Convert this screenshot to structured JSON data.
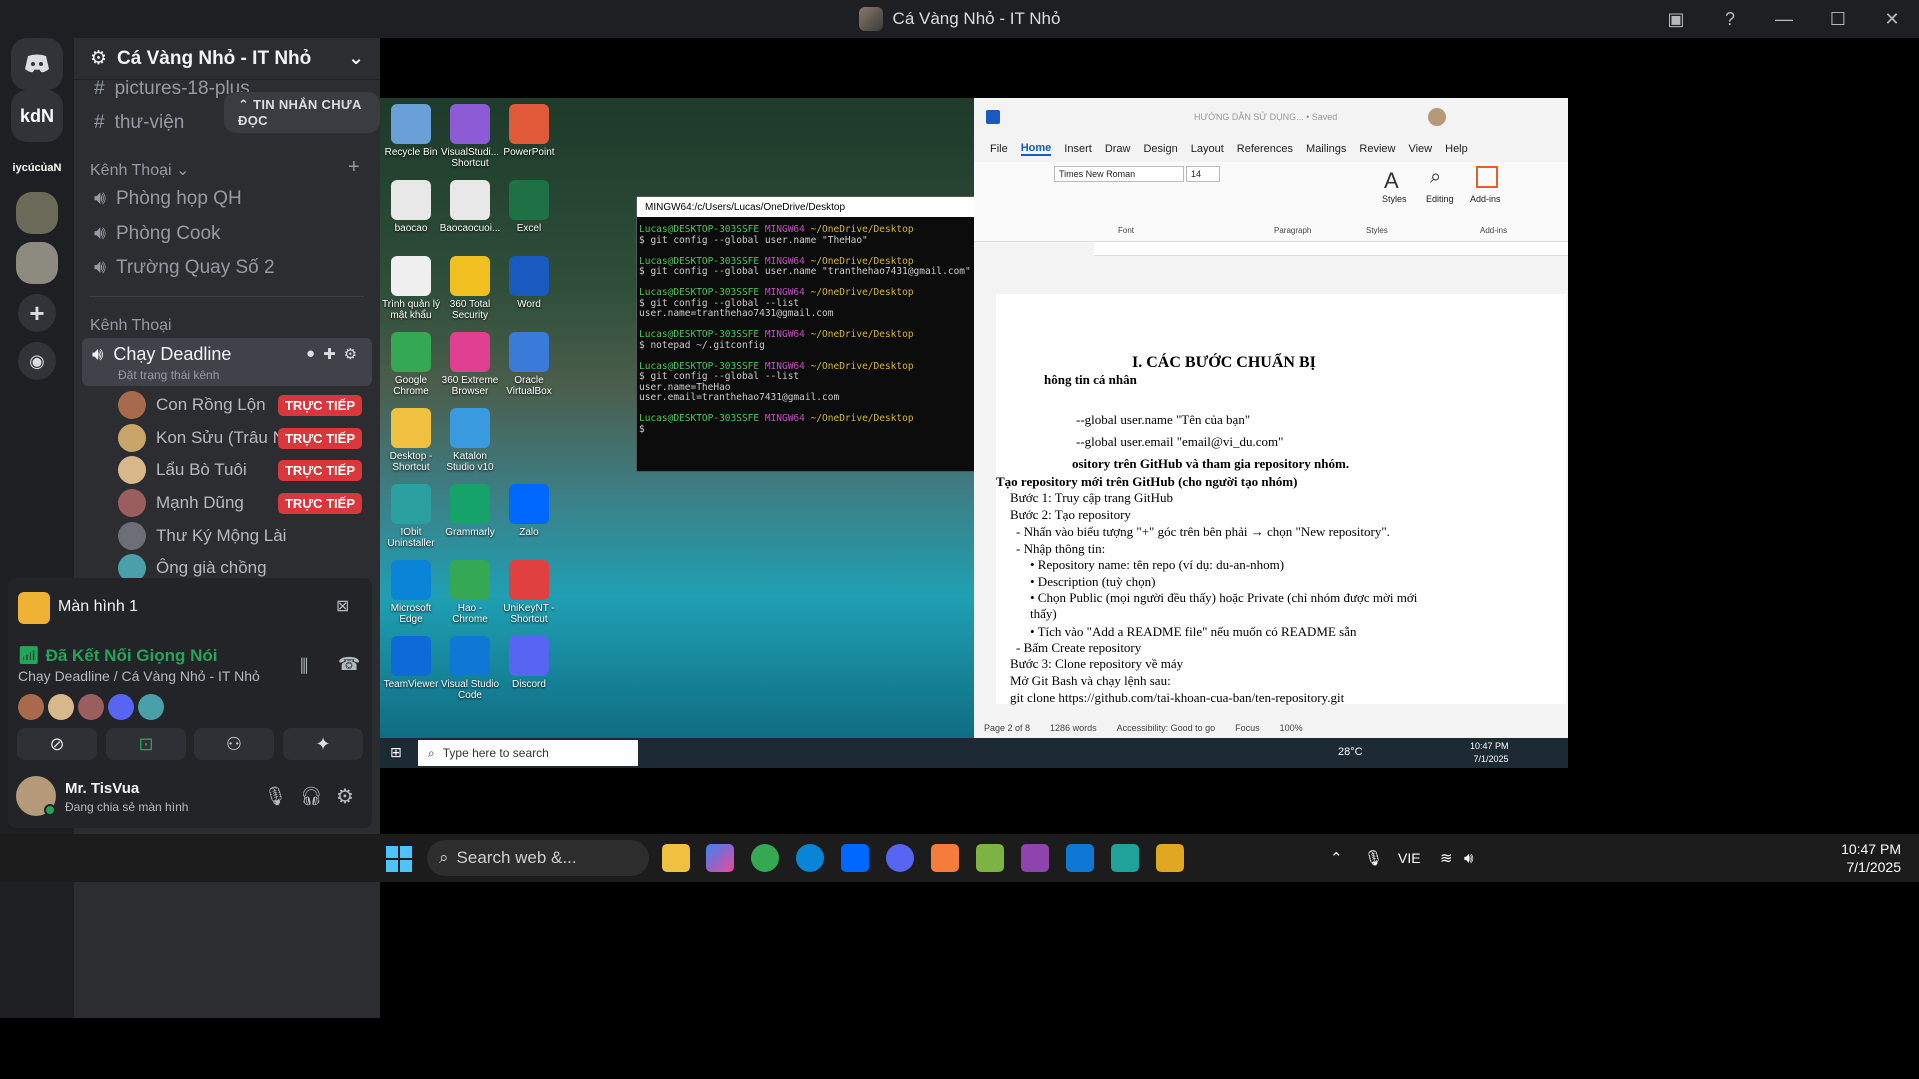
{
  "window": {
    "title": "Cá Vàng Nhỏ - IT Nhỏ"
  },
  "rail": {
    "items": [
      "kdN",
      "iycúcủaN"
    ]
  },
  "sidebar": {
    "guild_name": "Cá Vàng Nhỏ - IT Nhỏ",
    "text_channels": [
      "pictures-18-plus",
      "thư-viện"
    ],
    "unread_pill": "TIN NHẮN CHƯA ĐỌC",
    "category_voice_1": "Kênh Thoại",
    "voice_channels_1": [
      "Phòng họp QH",
      "Phòng Cook",
      "Trường Quay Số 2"
    ],
    "category_voice_2": "Kênh Thoại",
    "active_channel": {
      "name": "Chạy Deadline",
      "status": "Đặt trạng thái kênh"
    },
    "members": [
      {
        "name": "Con Rồng Lộn",
        "live": "TRỰC TIẾP"
      },
      {
        "name": "Kon Sửu (Trâu Nư...",
        "live": "TRỰC TIẾP"
      },
      {
        "name": "Lẩu Bò Tuôi",
        "live": "TRỰC TIẾP"
      },
      {
        "name": "Mạnh Dũng",
        "live": "TRỰC TIẾP"
      },
      {
        "name": "Thư Ký Mộng Lài",
        "live": ""
      },
      {
        "name": "Ông già chồng",
        "live": ""
      }
    ]
  },
  "screen_panel": {
    "label": "Màn hình 1"
  },
  "voice_panel": {
    "status": "Đã Kết Nối Giọng Nói",
    "location": "Chạy Deadline / Cá Vàng Nhỏ - IT Nhỏ"
  },
  "user_panel": {
    "name": "Mr. TisVua",
    "status": "Đang chia sẻ màn hình"
  },
  "stream": {
    "desktop_icons": [
      "Recycle Bin",
      "VisualStudi... Shortcut",
      "PowerPoint",
      "baocao",
      "Baocaocuoi...",
      "Excel",
      "Trình quản lý mật khẩu",
      "360 Total Security",
      "Word",
      "Google Chrome",
      "360 Extreme Browser",
      "Oracle VirtualBox",
      "Desktop - Shortcut",
      "Katalon Studio v10",
      "",
      "IObit Uninstaller",
      "Grammarly",
      "Zalo",
      "Microsoft Edge",
      "Hao - Chrome",
      "UniKeyNT - Shortcut",
      "TeamViewer",
      "Visual Studio Code",
      "Discord"
    ],
    "terminal": {
      "title": "MINGW64:/c/Users/Lucas/OneDrive/Desktop",
      "prompt_user": "Lucas@DESKTOP-303SSFE",
      "prompt_env": "MINGW64",
      "prompt_path": "~/OneDrive/Desktop",
      "commands": [
        "$ git config --global user.name \"TheHao\"",
        "$ git config --global user.name \"tranthehao7431@gmail.com\"",
        "$ git config --global --list",
        "user.name=tranthehao7431@gmail.com",
        "$ notepad ~/.gitconfig",
        "$ git config --global --list",
        "user.name=TheHao",
        "user.email=tranthehao7431@gmail.com",
        "$"
      ]
    },
    "word": {
      "doc_title": "HƯỚNG DẪN SỬ DỤNG... • Saved",
      "tabs": [
        "File",
        "Home",
        "Insert",
        "Draw",
        "Design",
        "Layout",
        "References",
        "Mailings",
        "Review",
        "View",
        "Help"
      ],
      "font": "Times New Roman",
      "font_size": "14",
      "groups": [
        "Font",
        "Paragraph",
        "Styles",
        "Add-ins"
      ],
      "ribbon_buttons": [
        "Styles",
        "Editing",
        "Add-ins"
      ],
      "lines": [
        "I.      CÁC BƯỚC CHUẨN BỊ",
        "hông tin cá nhân",
        "--global user.name \"Tên của bạn\"",
        "--global user.email \"email@vi_du.com\"",
        "ository trên GitHub và tham gia repository nhóm.",
        "Tạo repository mới trên GitHub (cho người tạo nhóm)",
        "Bước 1: Truy cập trang GitHub",
        "Bước 2: Tạo repository",
        "-  Nhấn vào biểu tượng \"+\" góc trên bên phải → chọn \"New repository\".",
        "-  Nhập thông tin:",
        "•  Repository name: tên repo (ví dụ: du-an-nhom)",
        "•  Description (tuỳ chọn)",
        "•  Chọn Public (mọi người đều thấy) hoặc Private (chỉ nhóm được mời mới",
        "    thấy)",
        "•  Tích vào \"Add a README file\" nếu muốn có README sẵn",
        "-  Bấm Create repository",
        "Bước 3: Clone repository về máy",
        "Mở Git Bash và chạy lệnh sau:",
        "git clone https://github.com/tai-khoan-cua-ban/ten-repository.git"
      ],
      "status": [
        "Page 2 of 8",
        "1286 words",
        "Accessibility: Good to go",
        "Focus",
        "100%"
      ]
    },
    "inner_taskbar": {
      "search": "Type here to search",
      "weather": "28°C",
      "time": "10:47 PM",
      "date": "7/1/2025"
    }
  },
  "taskbar": {
    "search": "Search web &...",
    "lang": "VIE",
    "time": "10:47 PM",
    "date": "7/1/2025"
  }
}
